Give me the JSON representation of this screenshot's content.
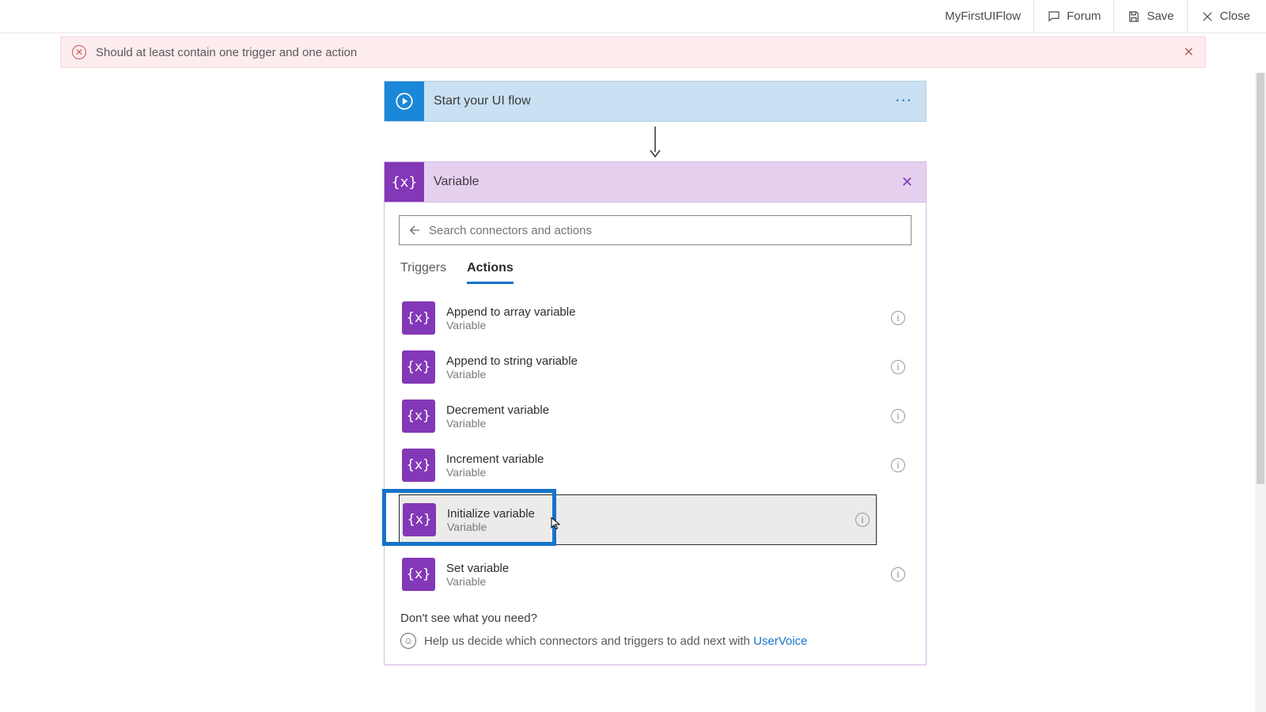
{
  "toolbar": {
    "flow_name": "MyFirstUIFlow",
    "forum": "Forum",
    "save": "Save",
    "close": "Close"
  },
  "banner": {
    "message": "Should at least contain one trigger and one action"
  },
  "start_card": {
    "title": "Start your UI flow"
  },
  "variable_panel": {
    "title": "Variable",
    "search_placeholder": "Search connectors and actions",
    "tabs": {
      "triggers": "Triggers",
      "actions": "Actions"
    },
    "actions": [
      {
        "title": "Append to array variable",
        "subtitle": "Variable"
      },
      {
        "title": "Append to string variable",
        "subtitle": "Variable"
      },
      {
        "title": "Decrement variable",
        "subtitle": "Variable"
      },
      {
        "title": "Increment variable",
        "subtitle": "Variable"
      },
      {
        "title": "Initialize variable",
        "subtitle": "Variable"
      },
      {
        "title": "Set variable",
        "subtitle": "Variable"
      }
    ],
    "footer_q": "Don't see what you need?",
    "footer_text": "Help us decide which connectors and triggers to add next with ",
    "footer_link": "UserVoice"
  }
}
